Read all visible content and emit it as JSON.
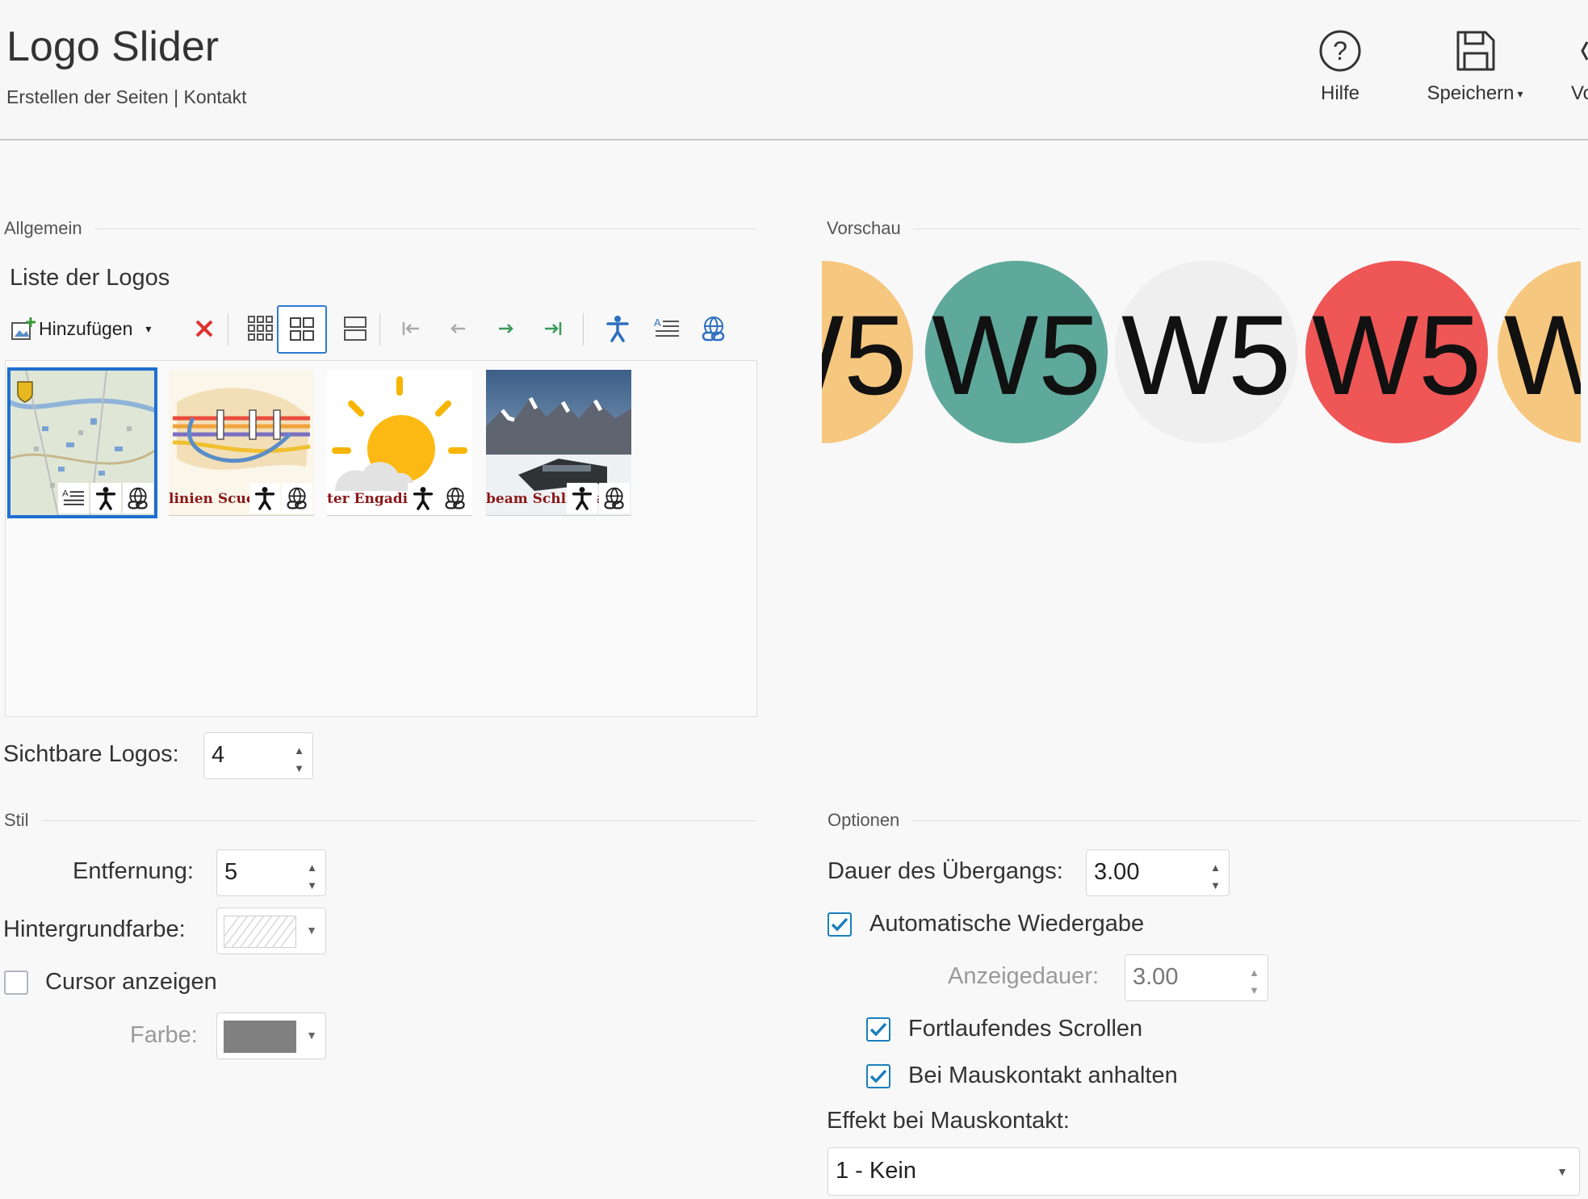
{
  "header": {
    "title": "Logo Slider",
    "breadcrumb": "Erstellen der Seiten | Kontakt",
    "help_label": "Hilfe",
    "save_label": "Speichern",
    "next_label_partial": "Vo"
  },
  "general": {
    "section_label": "Allgemein",
    "list_title": "Liste der Logos",
    "add_label": "Hinzufügen",
    "visible_logos_label": "Sichtbare Logos:",
    "visible_logos_value": "4"
  },
  "logos": [
    {
      "caption": "",
      "badges": [
        "text-icon",
        "accessibility-icon",
        "link-icon"
      ],
      "selected": true
    },
    {
      "caption": "linien Scuol",
      "badges": [
        "accessibility-icon",
        "link-icon"
      ],
      "selected": false
    },
    {
      "caption": "ter Engadin",
      "badges": [
        "accessibility-icon",
        "link-icon"
      ],
      "selected": false
    },
    {
      "caption": "beam Schlivera",
      "badges": [
        "accessibility-icon",
        "link-icon"
      ],
      "selected": false
    }
  ],
  "preview": {
    "section_label": "Vorschau",
    "logo_text": "W5",
    "circle_colors": [
      "#f6c77f",
      "#5fa89c",
      "#efefef",
      "#ef5656",
      "#f6c77f"
    ]
  },
  "style": {
    "section_label": "Stil",
    "distance_label": "Entfernung:",
    "distance_value": "5",
    "bg_color_label": "Hintergrundfarbe:",
    "show_cursor_label": "Cursor anzeigen",
    "show_cursor_checked": false,
    "color_label": "Farbe:",
    "cursor_color": "#808080"
  },
  "options": {
    "section_label": "Optionen",
    "transition_label": "Dauer des Übergangs:",
    "transition_value": "3.00",
    "autoplay_label": "Automatische Wiedergabe",
    "autoplay_checked": true,
    "display_duration_label": "Anzeigedauer:",
    "display_duration_value": "3.00",
    "continuous_scroll_label": "Fortlaufendes Scrollen",
    "continuous_scroll_checked": true,
    "pause_on_hover_label": "Bei Mauskontakt anhalten",
    "pause_on_hover_checked": true,
    "hover_effect_label": "Effekt bei Mauskontakt:",
    "hover_effect_value": "1 - Kein"
  },
  "colors": {
    "accent": "#1f6fd1",
    "green_arrow": "#3a9a5c",
    "checkbox": "#1b7fbd"
  }
}
